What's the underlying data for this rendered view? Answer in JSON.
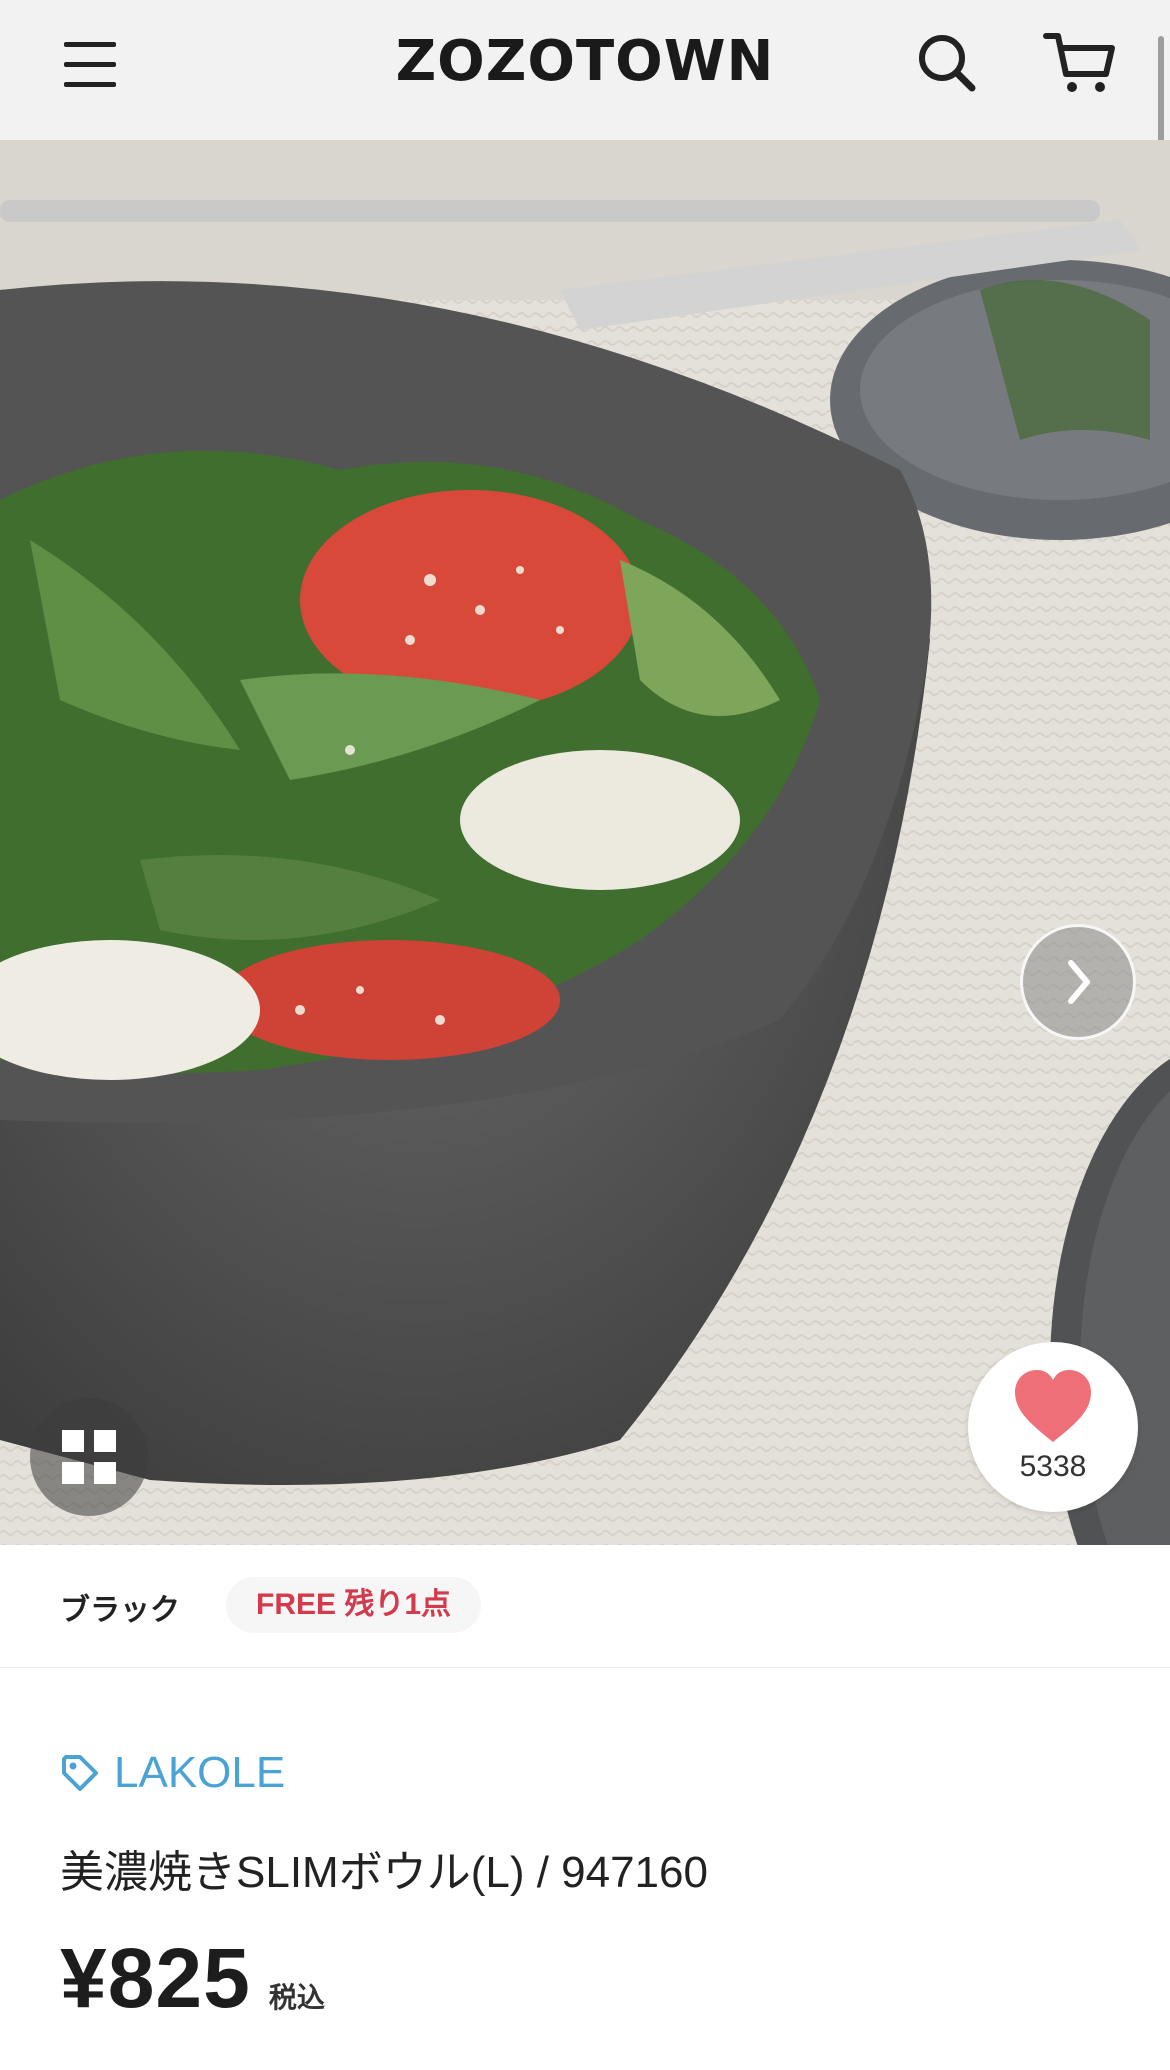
{
  "header": {
    "logo": "ZOZOTOWN",
    "icons": {
      "menu": "hamburger-menu-icon",
      "search": "search-icon",
      "cart": "cart-icon"
    }
  },
  "gallery": {
    "image_alt": "Black bowl with salad of tomato, mozzarella and greens",
    "next_icon": "chevron-right-icon",
    "grid_icon": "grid-icon",
    "favorite": {
      "icon": "heart-icon",
      "count": "5338",
      "color": "#ee6f78"
    }
  },
  "variant": {
    "color": "ブラック",
    "stock": "FREE 残り1点",
    "stock_color": "#d33a4b"
  },
  "product": {
    "brand_icon": "tag-icon",
    "brand": "LAKOLE",
    "brand_color": "#4aa3d4",
    "title": "美濃焼きSLIMボウル(L) / 947160",
    "price": "¥825",
    "tax_label": "税込"
  }
}
